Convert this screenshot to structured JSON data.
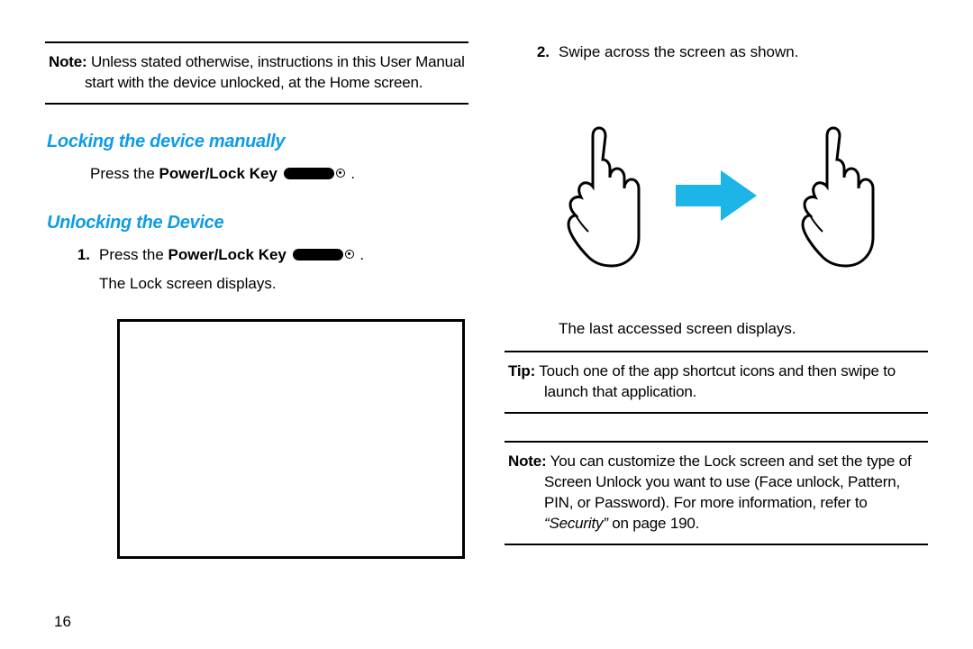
{
  "left": {
    "note_label": "Note:",
    "note_text": " Unless stated otherwise, instructions in this User Manual",
    "note_text2": "start with the device unlocked, at the Home screen.",
    "h1": "Locking the device manually",
    "press_prefix": "Press the ",
    "power_lock": "Power/Lock Key",
    "period": " .",
    "h2": "Unlocking the Device",
    "step1_num": "1.",
    "step1a": "Press the ",
    "step1b": "Power/Lock Key",
    "step1c": " .",
    "step1d": "The Lock screen displays."
  },
  "right": {
    "step2_num": "2.",
    "step2": "Swipe across the screen as shown.",
    "after": "The last accessed screen displays.",
    "tip_label": "Tip:",
    "tip_text": " Touch one of the app shortcut icons and then swipe to",
    "tip_text2": "launch that application.",
    "note_label": "Note:",
    "note_line1": " You can customize the Lock screen and set the type of",
    "note_line2": "Screen Unlock you want to use (Face unlock, Pattern,",
    "note_line3": "PIN, or Password). For more information, refer to ",
    "note_ref": "“Security” ",
    "note_ref_tail": " on page 190."
  },
  "page_number": "16"
}
